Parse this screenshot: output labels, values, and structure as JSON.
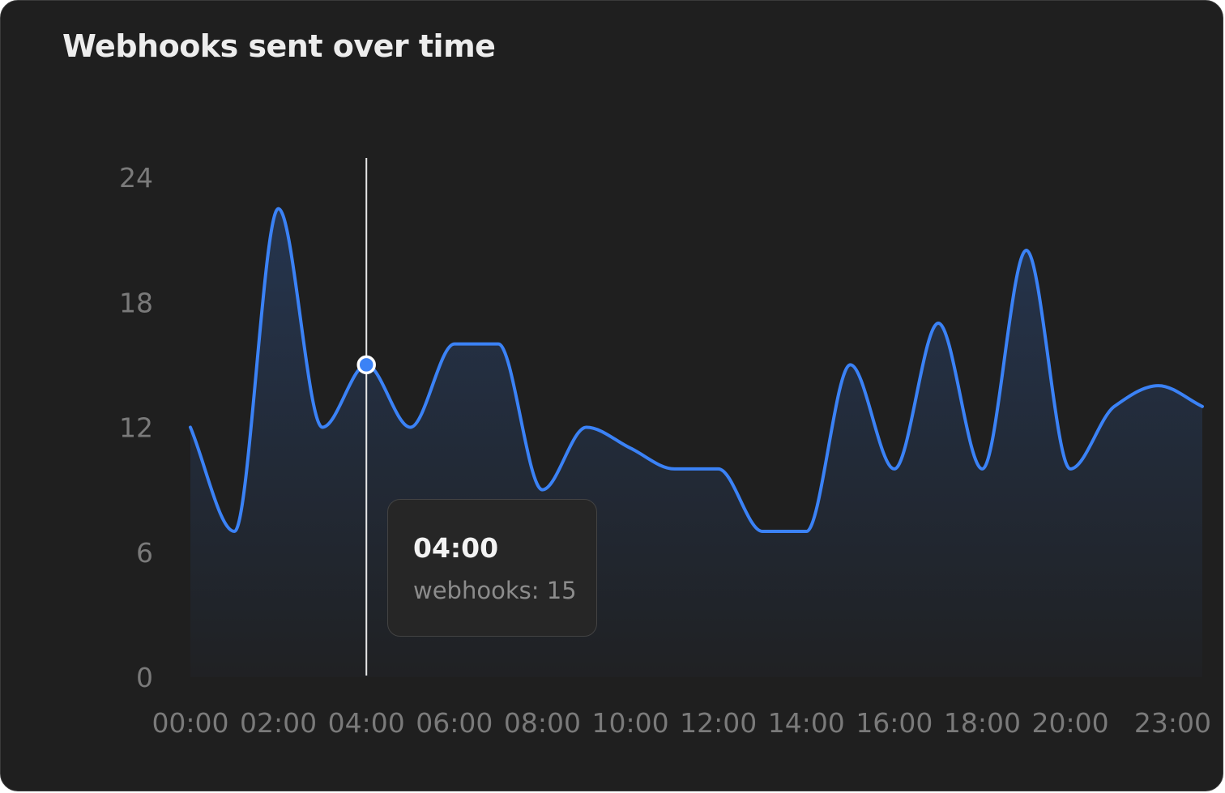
{
  "card": {
    "title": "Webhooks sent over time"
  },
  "chart_data": {
    "type": "area",
    "title": "Webhooks sent over time",
    "xlabel": "",
    "ylabel": "",
    "grid": false,
    "legend": "none",
    "x": [
      "00:00",
      "01:00",
      "02:00",
      "03:00",
      "04:00",
      "05:00",
      "06:00",
      "07:00",
      "08:00",
      "09:00",
      "10:00",
      "11:00",
      "12:00",
      "13:00",
      "14:00",
      "15:00",
      "16:00",
      "17:00",
      "18:00",
      "19:00",
      "20:00",
      "21:00",
      "22:00",
      "23:00"
    ],
    "x_tick_labels": [
      "00:00",
      "02:00",
      "04:00",
      "06:00",
      "08:00",
      "10:00",
      "12:00",
      "14:00",
      "16:00",
      "18:00",
      "20:00",
      "23:00"
    ],
    "y_ticks": [
      0,
      6,
      12,
      18,
      24
    ],
    "ylim": [
      0,
      24
    ],
    "series": [
      {
        "values": [
          12,
          7,
          22.5,
          12,
          15,
          12,
          16,
          16,
          9,
          12,
          11,
          10,
          10,
          7,
          7,
          15,
          10,
          17,
          10,
          20.5,
          10,
          13,
          14,
          13
        ],
        "color": "#3b82f6"
      }
    ],
    "hover": {
      "index": 4
    }
  },
  "tooltip": {
    "title": "04:00",
    "label": "webhooks",
    "value": "15",
    "text": "webhooks: 15"
  },
  "colors": {
    "background": "#1f1f1f",
    "line": "#3b82f6",
    "axis_text": "#7a7a7a",
    "crosshair": "#e6e6e6"
  }
}
